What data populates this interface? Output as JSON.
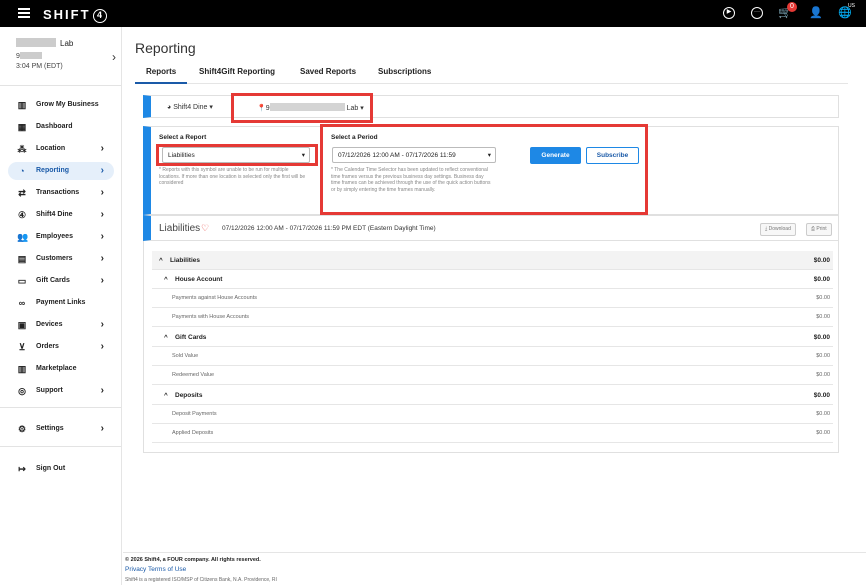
{
  "topbar": {
    "logo": "SHIFT",
    "logo_mark": "4",
    "cart_count": "0",
    "region": "US",
    "icons": [
      "play-icon",
      "chat-icon",
      "cart-icon",
      "user-icon",
      "globe-icon"
    ]
  },
  "store": {
    "name_suffix": "Lab",
    "id_prefix": "9",
    "time": "3:04 PM (EDT)"
  },
  "nav": {
    "items": [
      {
        "label": "Grow My Business",
        "icon": "chart-icon",
        "arrow": ""
      },
      {
        "label": "Dashboard",
        "icon": "grid-icon",
        "arrow": ""
      },
      {
        "label": "Location",
        "icon": "network-icon",
        "arrow": "›"
      },
      {
        "label": "Reporting",
        "icon": "reporting-icon",
        "arrow": "›"
      },
      {
        "label": "Transactions",
        "icon": "swap-icon",
        "arrow": "›"
      },
      {
        "label": "Shift4 Dine",
        "icon": "dine-icon",
        "arrow": "›"
      },
      {
        "label": "Employees",
        "icon": "people-icon",
        "arrow": "›"
      },
      {
        "label": "Customers",
        "icon": "contact-card-icon",
        "arrow": "›"
      },
      {
        "label": "Gift Cards",
        "icon": "gift-card-icon",
        "arrow": "›"
      },
      {
        "label": "Payment Links",
        "icon": "link-icon",
        "arrow": ""
      },
      {
        "label": "Devices",
        "icon": "devices-icon",
        "arrow": "›"
      },
      {
        "label": "Orders",
        "icon": "basket-icon",
        "arrow": "›"
      },
      {
        "label": "Marketplace",
        "icon": "store-icon",
        "arrow": ""
      },
      {
        "label": "Support",
        "icon": "lifebuoy-icon",
        "arrow": "›"
      },
      {
        "label": "Settings",
        "icon": "gear-icon",
        "arrow": "›"
      },
      {
        "label": "Sign Out",
        "icon": "signout-icon",
        "arrow": ""
      }
    ]
  },
  "page": {
    "title": "Reporting",
    "tabs": [
      "Reports",
      "Shift4Gift Reporting",
      "Saved Reports",
      "Subscriptions"
    ]
  },
  "filters": {
    "dine": "Shift4 Dine",
    "location_prefix": "9",
    "location_suffix": "Lab"
  },
  "report": {
    "select_label": "Select a Report",
    "selected": "Liabilities",
    "note": "* Reports with this symbol are unable to be run for multiple locations. If more than one location is selected only the first will be considered"
  },
  "period": {
    "label": "Select a Period",
    "value": "07/12/2026 12:00 AM - 07/17/2026 11:59",
    "note": "* The Calendar Time Selector has been updated to reflect conventional time frames versus the previous business day settings. Business day time frames can be achieved through the use of the quick action buttons or by simply entering the time frames manually.",
    "generate": "Generate",
    "subscribe": "Subscribe"
  },
  "result": {
    "title": "Liabilities",
    "range": "07/12/2026 12:00 AM - 07/17/2026 11:59 PM EDT (Eastern Daylight Time)",
    "download": "Download",
    "print": "Print"
  },
  "table": {
    "rows": [
      {
        "label": "Liabilities",
        "value": "$0.00",
        "level": "top"
      },
      {
        "label": "House Account",
        "value": "$0.00",
        "level": "group"
      },
      {
        "label": "Payments against House Accounts",
        "value": "$0.00",
        "level": "item"
      },
      {
        "label": "Payments with House Accounts",
        "value": "$0.00",
        "level": "item"
      },
      {
        "label": "Gift Cards",
        "value": "$0.00",
        "level": "group"
      },
      {
        "label": "Sold Value",
        "value": "$0.00",
        "level": "item"
      },
      {
        "label": "Redeemed Value",
        "value": "$0.00",
        "level": "item"
      },
      {
        "label": "Deposits",
        "value": "$0.00",
        "level": "group"
      },
      {
        "label": "Deposit Payments",
        "value": "$0.00",
        "level": "item"
      },
      {
        "label": "Applied Deposits",
        "value": "$0.00",
        "level": "item"
      }
    ]
  },
  "footer": {
    "copyright": "© 2026 Shift4, a FOUR company. All rights reserved.",
    "privacy": "Privacy",
    "terms": "Terms of Use",
    "registered": "Shift4 is a registered ISO/MSP of Citizens Bank, N.A. Providence, RI"
  },
  "colors": {
    "accent": "#1e88e5",
    "highlight": "#e53935",
    "topbar": "#000000",
    "active_nav_bg": "#e5effa"
  }
}
